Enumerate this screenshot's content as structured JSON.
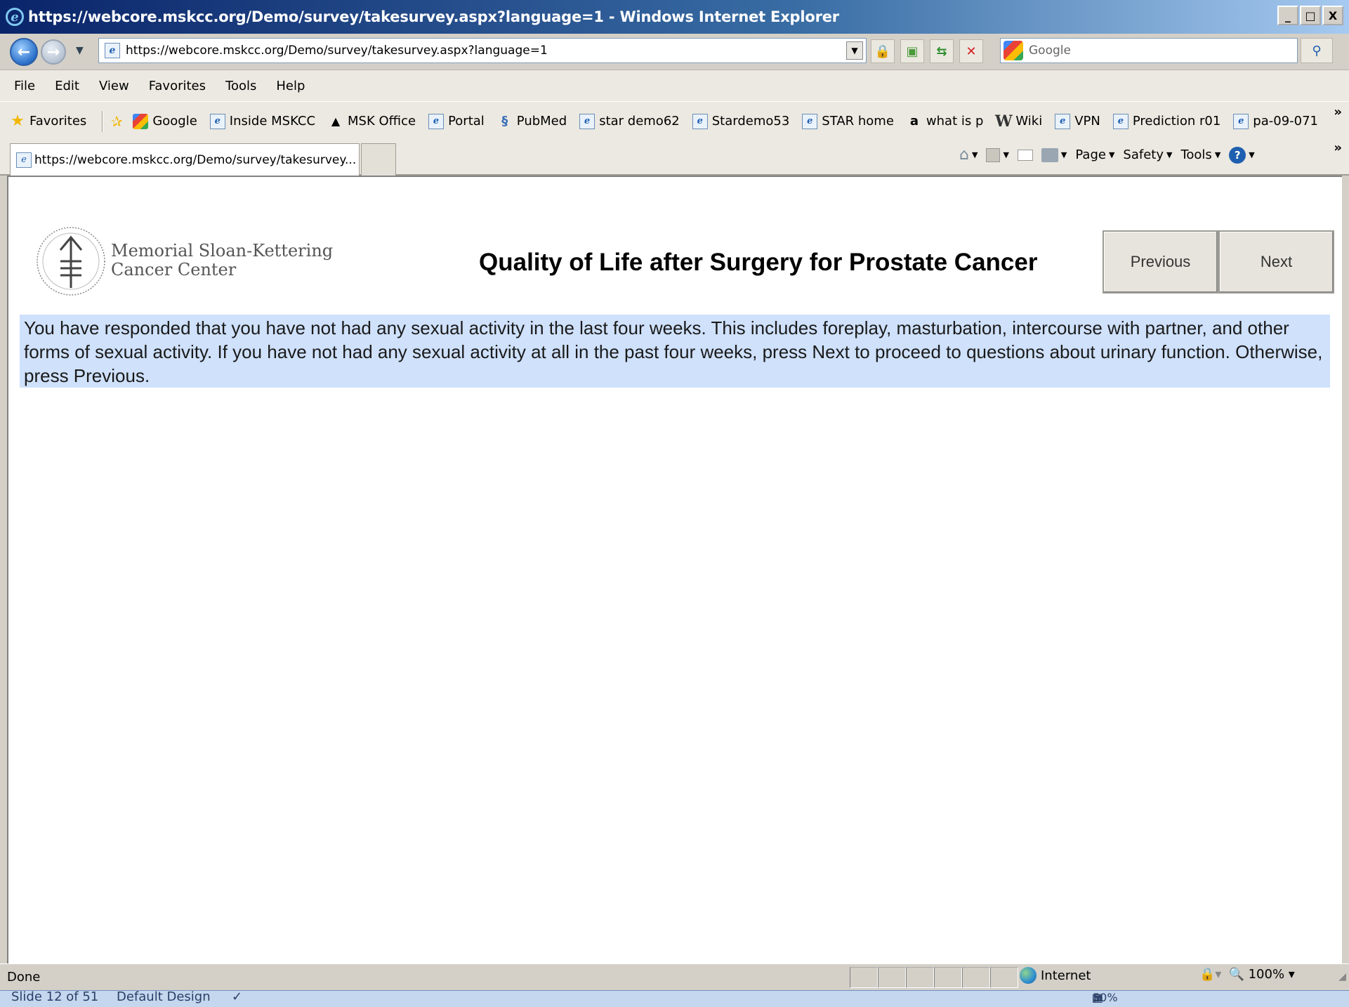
{
  "window": {
    "title": "https://webcore.mskcc.org/Demo/survey/takesurvey.aspx?language=1 - Windows Internet Explorer",
    "minimize": "_",
    "maximize": "□",
    "close": "X"
  },
  "address": {
    "url": "https://webcore.mskcc.org/Demo/survey/takesurvey.aspx?language=1",
    "search_placeholder": "Google"
  },
  "menu": [
    "File",
    "Edit",
    "View",
    "Favorites",
    "Tools",
    "Help"
  ],
  "favorites": {
    "label": "Favorites",
    "items": [
      {
        "label": "Google",
        "icon": "google-icon"
      },
      {
        "label": "Inside MSKCC",
        "icon": "ie-page-icon"
      },
      {
        "label": "MSK Office",
        "icon": "penguin-icon"
      },
      {
        "label": "Portal",
        "icon": "ie-page-icon"
      },
      {
        "label": "PubMed",
        "icon": "pubmed-icon"
      },
      {
        "label": "star demo62",
        "icon": "ie-page-icon"
      },
      {
        "label": "Stardemo53",
        "icon": "ie-page-icon"
      },
      {
        "label": "STAR home",
        "icon": "ie-page-icon"
      },
      {
        "label": "what is p",
        "icon": "amazon-icon"
      },
      {
        "label": "Wiki",
        "icon": "wikipedia-icon"
      },
      {
        "label": "VPN",
        "icon": "ie-page-icon"
      },
      {
        "label": "Prediction r01",
        "icon": "ie-page-icon"
      },
      {
        "label": "pa-09-071",
        "icon": "ie-page-icon"
      }
    ],
    "overflow": "»"
  },
  "tab": {
    "label": "https://webcore.mskcc.org/Demo/survey/takesurvey..."
  },
  "commands": {
    "page": "Page",
    "safety": "Safety",
    "tools": "Tools",
    "overflow": "»"
  },
  "page": {
    "logo_line1": "Memorial Sloan-Kettering",
    "logo_line2": "Cancer Center",
    "title": "Quality of Life after Surgery for Prostate Cancer",
    "previous_label": "Previous",
    "next_label": "Next",
    "message": "You have responded that you have not had any sexual activity in the last four weeks. This includes foreplay, masturbation, intercourse with partner, and other forms of sexual activity. If you have not had any sexual activity at all in the past four weeks, press Next to proceed to questions about urinary function. Otherwise, press Previous."
  },
  "status": {
    "text": "Done",
    "zone": "Internet",
    "zoom": "100%"
  },
  "ppt": {
    "slide": "Slide 12 of 51",
    "design": "Default Design",
    "zoom": "50%"
  }
}
